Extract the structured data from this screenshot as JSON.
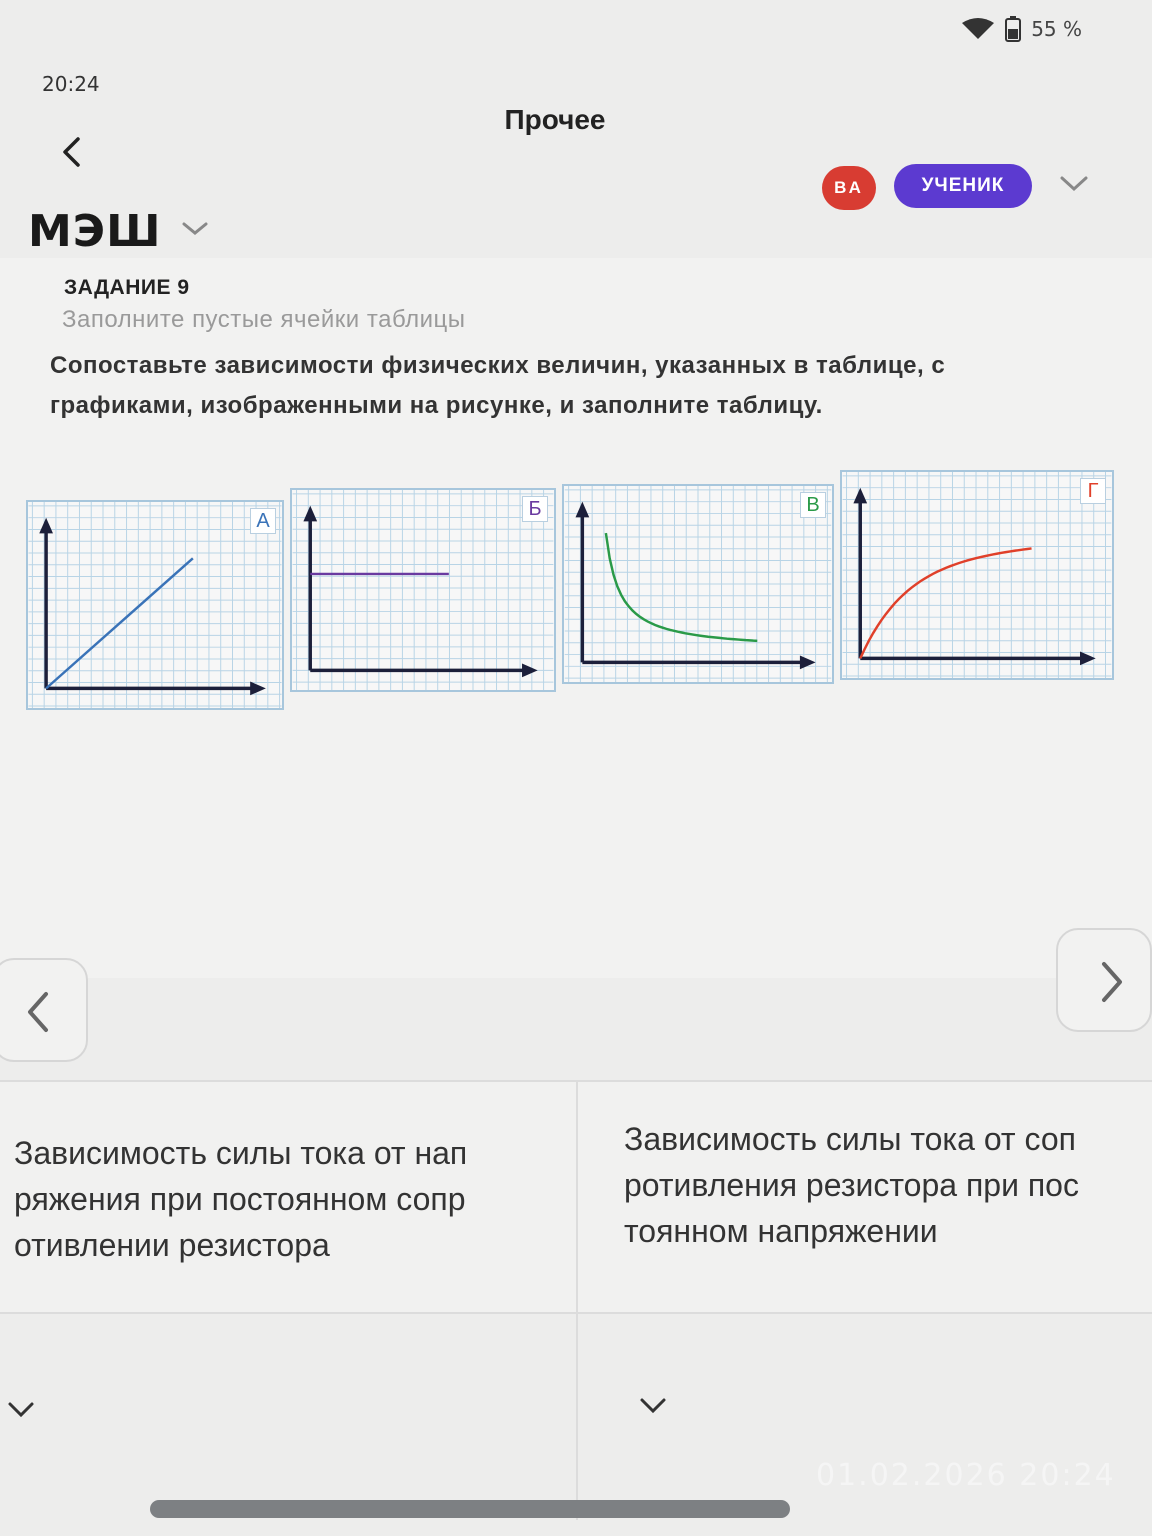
{
  "status": {
    "time": "20:24",
    "battery": "55 %"
  },
  "header": {
    "title": "Прочее",
    "avatar_initials": "ВА",
    "role_label": "УЧЕНИК",
    "logo": "МЭШ"
  },
  "task": {
    "label": "ЗАДАНИЕ 9",
    "hint": "Заполните пустые ячейки таблицы",
    "text": "Сопоставьте зависимости физических величин, указанных в таблице, с графиками, изображенными на рисунке, и заполните таблицу."
  },
  "graphs": [
    {
      "label": "А",
      "curve": "linear-increasing",
      "color": "#3a73b8"
    },
    {
      "label": "Б",
      "curve": "constant",
      "color": "#6a3aa0"
    },
    {
      "label": "В",
      "curve": "inverse-decreasing",
      "color": "#2a9a48"
    },
    {
      "label": "Г",
      "curve": "saturating-increasing",
      "color": "#e0402a"
    }
  ],
  "table": {
    "rows": [
      {
        "text": "Зависимость силы тока от нап ряжения при постоянном сопр отивлении резистора"
      },
      {
        "text": "Зависимость силы тока от соп ротивления резистора при пос тоянном напряжении"
      }
    ]
  },
  "photo_stamp": "01.02.2026  20:24"
}
